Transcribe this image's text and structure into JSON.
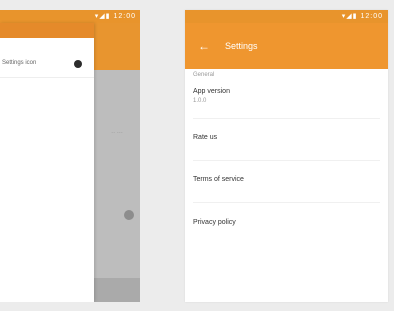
{
  "left_phone": {
    "status_icons": "▾◢▮ 12:00",
    "drawer_item": {
      "label": "Settings icon"
    },
    "content_text": "·· ···"
  },
  "right_phone": {
    "status_icons": "▾◢▮ 12:00",
    "app_bar": {
      "back_icon": "arrow-back-icon",
      "title": "Settings"
    },
    "section_header": "General",
    "preferences": [
      {
        "title": "App version",
        "summary": "1.0.0"
      },
      {
        "title": "Rate us",
        "summary": ""
      },
      {
        "title": "Terms of service",
        "summary": ""
      },
      {
        "title": "Privacy policy",
        "summary": ""
      }
    ]
  },
  "colors": {
    "accent": "#ef962f",
    "status_bar": "#e8942c",
    "scrim": "#bdbdbd"
  }
}
